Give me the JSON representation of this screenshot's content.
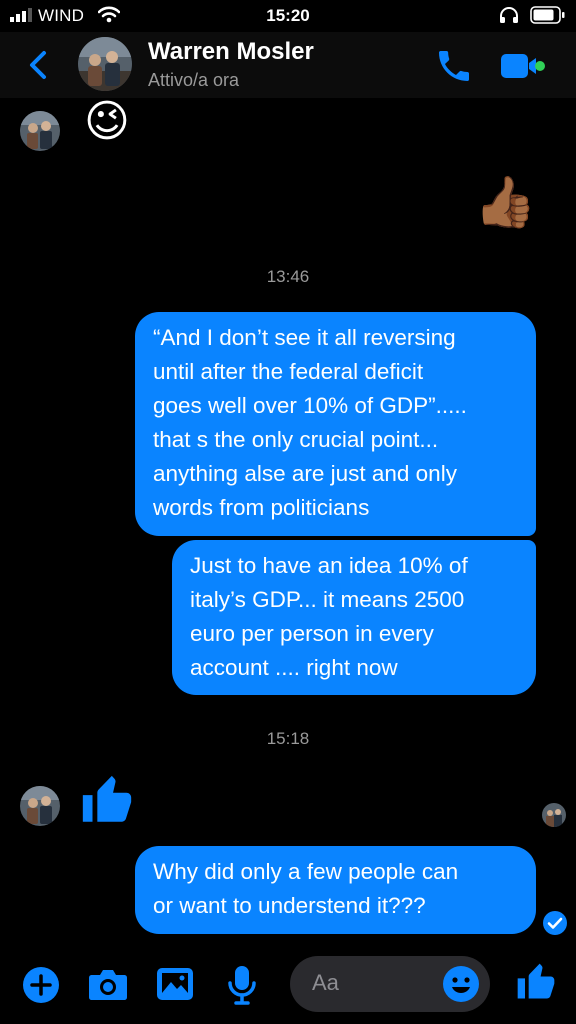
{
  "status_bar": {
    "carrier": "WIND",
    "time": "15:20"
  },
  "header": {
    "contact_name": "Warren Mosler",
    "presence": "Attivo/a ora"
  },
  "messages": {
    "incoming_emoji": "😉",
    "outgoing_emoji": "👍🏾",
    "timestamp_1": "13:46",
    "bubble_1": "“And I don’t see it all reversing\nuntil after the federal deficit\ngoes well over 10% of GDP”.....\nthat s the only crucial point...\nanything alse are just and only\nwords from politicians",
    "bubble_2": "Just to have an idea 10% of\nitaly’s GDP... it means 2500\neuro per person in every\naccount .... right now",
    "timestamp_2": "15:18",
    "bubble_3": "Why did only a few people can\nor want to understend it???"
  },
  "composer": {
    "placeholder": "Aa"
  },
  "colors": {
    "accent": "#0a84ff",
    "background": "#000000",
    "header_bg": "#0c0c0c",
    "secondary_text": "#9a9a9a",
    "online_dot": "#31d158",
    "input_bg": "#2a2a2e"
  }
}
